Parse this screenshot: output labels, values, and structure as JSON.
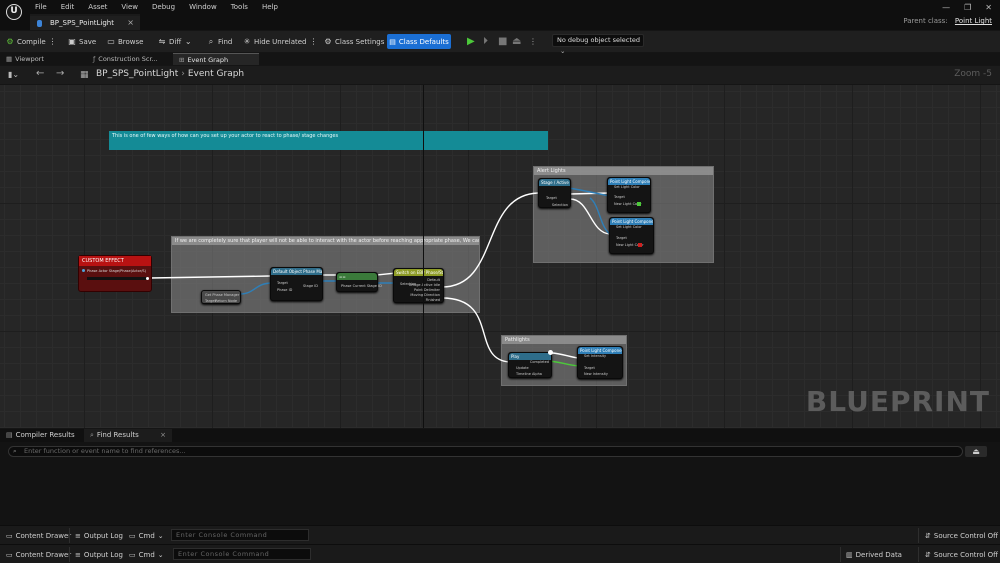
{
  "menu": [
    "File",
    "Edit",
    "Asset",
    "View",
    "Debug",
    "Window",
    "Tools",
    "Help"
  ],
  "window_controls": [
    "—",
    "❐",
    "✕"
  ],
  "document_tab": {
    "label": "BP_SPS_PointLight",
    "close": "×"
  },
  "parent_class": {
    "label": "Parent class:",
    "value": "Point Light"
  },
  "toolbar": {
    "compile": "Compile",
    "save": "Save",
    "browse": "Browse",
    "diff": "Diff",
    "find": "Find",
    "hide_unrelated": "Hide Unrelated",
    "class_settings": "Class Settings",
    "class_defaults": "Class Defaults",
    "debug_select": "No debug object selected"
  },
  "sub_tabs": [
    "Viewport",
    "Construction Scr...",
    "Event Graph"
  ],
  "graph": {
    "breadcrumb_root": "BP_SPS_PointLight",
    "breadcrumb_sep": "›",
    "breadcrumb_leaf": "Event Graph",
    "zoom": "Zoom -5",
    "watermark": "BLUEPRINT",
    "note": "This is one of few ways of how can you set up your actor to react to phase/ stage changes",
    "main_comment": "If we are completely sure that player will not be able to interact with the actor before reaching appropriate phase, We can skip the phase check...",
    "alert_comment": "Alert Lights",
    "pathlight_comment": "Pathlights",
    "custom_event": {
      "title": "CUSTOM EFFECT",
      "pin": "Phase Actor  Stage/Phase(Actor/S)"
    },
    "nodes": {
      "get_phase": {
        "title": "Default Object  Phase Manager",
        "pins": [
          "Target",
          "Phase ID",
          "Stage ID"
        ]
      },
      "equal": {
        "title": "==",
        "pins": [
          "Phase Current Stage ID"
        ]
      },
      "switch": {
        "title": "Switch on EBP Phase/Stage",
        "pins": [
          "Selection",
          "Default",
          "Bridge Active Idle",
          "Point Delimiter",
          "Moving Direction",
          "Finished"
        ]
      },
      "get_manager": {
        "title": "Get Phase Manager",
        "pins": [
          "Target",
          "Return Node"
        ]
      },
      "alert_get": {
        "title": "Stage / Active Stage ID",
        "pins": [
          "Target",
          "Selection"
        ]
      },
      "alert_set1": {
        "title": "Point Light Component",
        "pins": [
          "Set Light Color",
          "Target",
          "New Light Color"
        ]
      },
      "alert_set2": {
        "title": "Point Light Component",
        "pins": [
          "Set Light Color",
          "Target",
          "New Light Color"
        ]
      },
      "path_set": {
        "title": "Point Light Component",
        "pins": [
          "Set Intensity",
          "Target",
          "New Intensity"
        ]
      },
      "path_timeline": {
        "title": "Play",
        "pins": [
          "Completed",
          "Update",
          "Timeline Alpha"
        ]
      }
    }
  },
  "bottom": {
    "tabs": [
      "Compiler Results",
      "Find Results"
    ],
    "find_placeholder": "Enter function or event name to find references...",
    "find_button": "⏏"
  },
  "status": {
    "content_drawer": "Content Drawer",
    "output_log": "Output Log",
    "cmd": "Cmd",
    "console_placeholder": "Enter Console Command",
    "derived_data": "Derived Data",
    "source_control": "Source Control Off"
  },
  "colors": {
    "accent": "#1b6fd4",
    "event_red": "#b81212",
    "note_teal": "#148b96",
    "exec_white": "#ffffff",
    "bool_green": "#4cc93a",
    "struct_blue": "#2f7fb7"
  }
}
